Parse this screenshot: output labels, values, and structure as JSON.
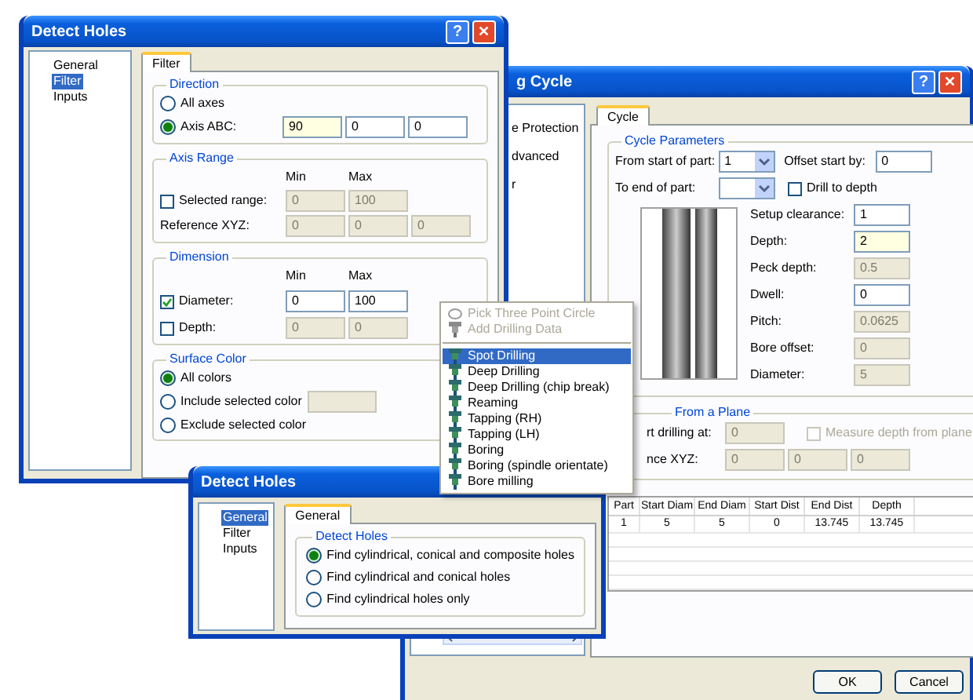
{
  "drilling_window": {
    "title": "g Cycle",
    "help_button": "?",
    "close_button": "✕",
    "tree": [
      "e Protection",
      "dvanced",
      "r"
    ],
    "tab": {
      "label": "Cycle",
      "selected": true
    },
    "cycle_parameters": {
      "title": "Cycle Parameters",
      "from_start": {
        "label": "From start of part:",
        "value": "1"
      },
      "to_end": {
        "label": "To end of part:"
      },
      "offset_start": {
        "label": "Offset start by:",
        "field": {
          "value": "0",
          "disabled": false,
          "highlighted": false
        }
      },
      "drill_to_depth": {
        "label": "Drill to depth",
        "checked": false
      },
      "params": [
        {
          "label": "Setup clearance:",
          "field": {
            "value": "1",
            "disabled": false,
            "highlighted": false
          }
        },
        {
          "label": "Depth:",
          "field": {
            "value": "2",
            "disabled": false,
            "highlighted": true
          }
        },
        {
          "label": "Peck depth:",
          "field": {
            "value": "0.5",
            "disabled": true,
            "highlighted": false
          }
        },
        {
          "label": "Dwell:",
          "field": {
            "value": "0",
            "disabled": false,
            "highlighted": false
          }
        },
        {
          "label": "Pitch:",
          "field": {
            "value": "0.0625",
            "disabled": true,
            "highlighted": false
          }
        },
        {
          "label": "Bore offset:",
          "field": {
            "value": "0",
            "disabled": true,
            "highlighted": false
          }
        },
        {
          "label": "Diameter:",
          "field": {
            "value": "5",
            "disabled": true,
            "highlighted": false
          }
        }
      ]
    },
    "plane": {
      "title": "From a Plane",
      "start_label": "rt drilling at:",
      "start_field": {
        "value": "0",
        "disabled": true,
        "highlighted": false
      },
      "measure": {
        "label": "Measure depth from plane",
        "checked": false,
        "disabled": true
      },
      "reference_label": "nce XYZ:",
      "reference_fields": [
        {
          "value": "0",
          "disabled": true,
          "highlighted": false
        },
        {
          "value": "0",
          "disabled": true,
          "highlighted": false
        },
        {
          "value": "0",
          "disabled": true,
          "highlighted": false
        }
      ]
    },
    "table": {
      "columns": [
        "Part",
        "Start Diam",
        "End Diam",
        "Start Dist",
        "End Dist",
        "Depth"
      ],
      "rows": [
        [
          "1",
          "5",
          "5",
          "0",
          "13.745",
          "13.745"
        ]
      ]
    },
    "buttons": [
      "OK",
      "Cancel"
    ]
  },
  "filter_window": {
    "title": "Detect Holes",
    "help_button": "?",
    "close_button": "✕",
    "tree": [
      {
        "label": "General",
        "selected": false
      },
      {
        "label": "Filter",
        "selected": true
      },
      {
        "label": "Inputs",
        "selected": false
      }
    ],
    "tab": {
      "label": "Filter",
      "selected": true
    },
    "direction": {
      "title": "Direction",
      "options": [
        {
          "label": "All axes",
          "selected": false
        },
        {
          "label": "Axis ABC:",
          "selected": true
        }
      ],
      "fields": [
        {
          "value": "90",
          "disabled": false,
          "highlighted": true
        },
        {
          "value": "0",
          "disabled": false,
          "highlighted": false
        },
        {
          "value": "0",
          "disabled": false,
          "highlighted": false
        }
      ]
    },
    "axis_range": {
      "title": "Axis Range",
      "min_header": "Min",
      "max_header": "Max",
      "selected_range": {
        "label": "Selected range:",
        "checked": false
      },
      "range_fields": [
        {
          "value": "0",
          "disabled": true,
          "highlighted": false
        },
        {
          "value": "100",
          "disabled": true,
          "highlighted": false
        }
      ],
      "reference_label": "Reference XYZ:",
      "reference_fields": [
        {
          "value": "0",
          "disabled": true,
          "highlighted": false
        },
        {
          "value": "0",
          "disabled": true,
          "highlighted": false
        },
        {
          "value": "0",
          "disabled": true,
          "highlighted": false
        }
      ]
    },
    "dimension": {
      "title": "Dimension",
      "min_header": "Min",
      "max_header": "Max",
      "rows": [
        {
          "label": "Diameter:",
          "checked": true,
          "fields": [
            {
              "value": "0",
              "disabled": false,
              "highlighted": false
            },
            {
              "value": "100",
              "disabled": false,
              "highlighted": false
            }
          ]
        },
        {
          "label": "Depth:",
          "checked": false,
          "fields": [
            {
              "value": "0",
              "disabled": true,
              "highlighted": false
            },
            {
              "value": "0",
              "disabled": true,
              "highlighted": false
            }
          ]
        }
      ]
    },
    "surface_color": {
      "title": "Surface Color",
      "options": [
        {
          "label": "All colors",
          "selected": true
        },
        {
          "label": "Include selected color",
          "selected": false
        },
        {
          "label": "Exclude selected color",
          "selected": false
        }
      ],
      "color_field": {
        "disabled": true,
        "highlighted": false
      }
    }
  },
  "general_window": {
    "title": "Detect Holes",
    "tree": [
      {
        "label": "General",
        "selected": true
      },
      {
        "label": "Filter",
        "selected": false
      },
      {
        "label": "Inputs",
        "selected": false
      }
    ],
    "tab": {
      "label": "General",
      "selected": true
    },
    "group": {
      "title": "Detect Holes",
      "options": [
        {
          "label": "Find cylindrical, conical and composite holes",
          "selected": true
        },
        {
          "label": "Find cylindrical and conical holes",
          "selected": false
        },
        {
          "label": "Find cylindrical holes only",
          "selected": false
        }
      ]
    }
  },
  "context_menu": {
    "top_items": [
      {
        "label": "Pick Three Point Circle",
        "disabled": true,
        "selected": false
      },
      {
        "label": "Add Drilling Data",
        "disabled": true,
        "selected": false
      }
    ],
    "items": [
      {
        "label": "Spot Drilling",
        "disabled": false,
        "selected": true
      },
      {
        "label": "Deep Drilling",
        "disabled": false,
        "selected": false
      },
      {
        "label": "Deep Drilling (chip break)",
        "disabled": false,
        "selected": false
      },
      {
        "label": "Reaming",
        "disabled": false,
        "selected": false
      },
      {
        "label": "Tapping (RH)",
        "disabled": false,
        "selected": false
      },
      {
        "label": "Tapping (LH)",
        "disabled": false,
        "selected": false
      },
      {
        "label": "Boring",
        "disabled": false,
        "selected": false
      },
      {
        "label": "Boring (spindle orientate)",
        "disabled": false,
        "selected": false
      },
      {
        "label": "Bore milling",
        "disabled": false,
        "selected": false
      }
    ]
  }
}
